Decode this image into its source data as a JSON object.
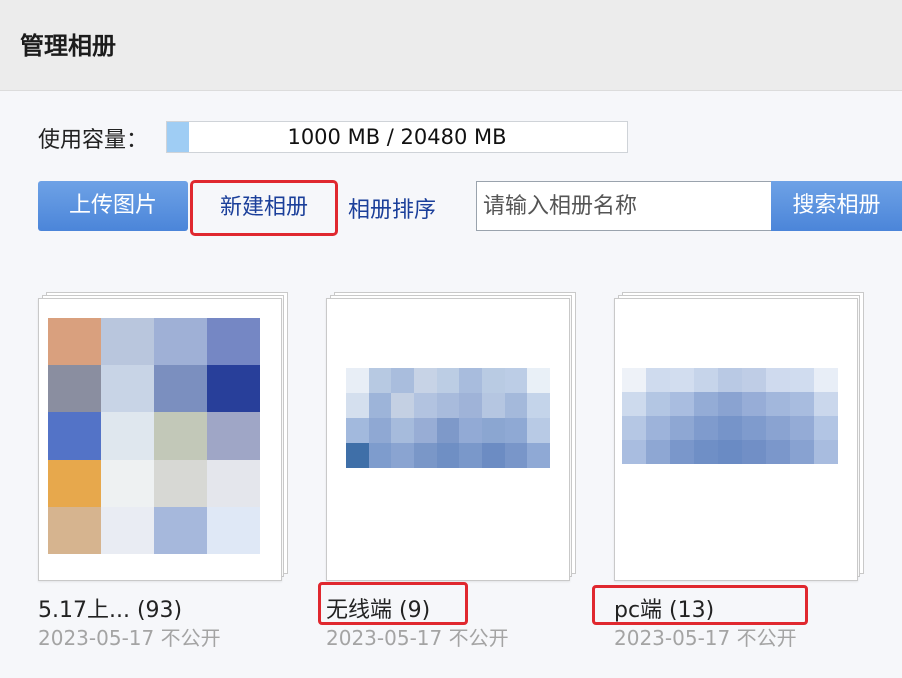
{
  "header": {
    "title": "管理相册"
  },
  "capacity": {
    "label": "使用容量：",
    "text": "1000 MB / 20480 MB",
    "used_fraction": 0.0488
  },
  "toolbar": {
    "upload_label": "上传图片",
    "new_album_label": "新建相册",
    "sort_label": "相册排序",
    "search_placeholder": "请输入相册名称",
    "search_button": "搜索相册"
  },
  "albums": [
    {
      "name": "5.17上... (93)",
      "date": "2023-05-17 不公开"
    },
    {
      "name": "无线端 (9)",
      "date": "2023-05-17 不公开"
    },
    {
      "name": "pc端 (13)",
      "date": "2023-05-17 不公开"
    }
  ],
  "colors": {
    "accent_blue": "#4b85d9",
    "link_blue": "#1b3f9a",
    "highlight_red": "#e0282f"
  }
}
